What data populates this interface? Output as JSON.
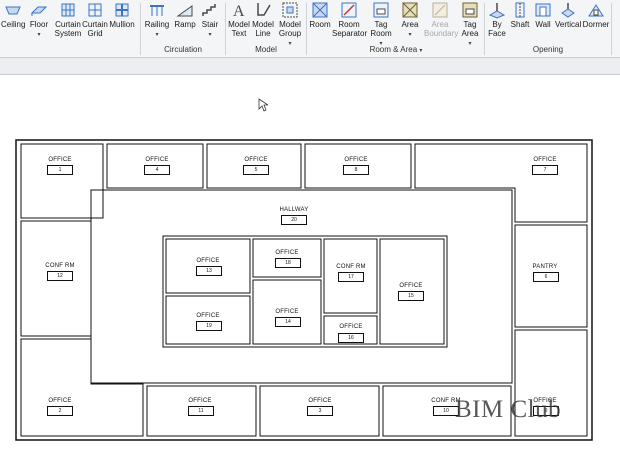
{
  "ribbon": {
    "tools": [
      {
        "label": "Ceiling",
        "icon": "ceiling-icon"
      },
      {
        "label": "Floor",
        "icon": "floor-icon"
      },
      {
        "label": "Curtain System",
        "icon": "curtain-system-icon"
      },
      {
        "label": "Curtain Grid",
        "icon": "curtain-grid-icon"
      },
      {
        "label": "Mullion",
        "icon": "mullion-icon"
      },
      {
        "label": "Railing",
        "icon": "railing-icon"
      },
      {
        "label": "Ramp",
        "icon": "ramp-icon"
      },
      {
        "label": "Stair",
        "icon": "stair-icon"
      },
      {
        "label": "Model Text",
        "icon": "model-text-icon"
      },
      {
        "label": "Model Line",
        "icon": "model-line-icon"
      },
      {
        "label": "Model Group",
        "icon": "model-group-icon"
      },
      {
        "label": "Room",
        "icon": "room-icon"
      },
      {
        "label": "Room Separator",
        "icon": "room-separator-icon"
      },
      {
        "label": "Tag Room",
        "icon": "tag-room-icon"
      },
      {
        "label": "Area",
        "icon": "area-icon"
      },
      {
        "label": "Area Boundary",
        "icon": "area-boundary-icon"
      },
      {
        "label": "Tag Area",
        "icon": "tag-area-icon"
      },
      {
        "label": "By Face",
        "icon": "by-face-icon"
      },
      {
        "label": "Shaft",
        "icon": "shaft-icon"
      },
      {
        "label": "Wall",
        "icon": "wall-opening-icon"
      },
      {
        "label": "Vertical",
        "icon": "vertical-opening-icon"
      },
      {
        "label": "Dormer",
        "icon": "dormer-icon"
      }
    ],
    "panels": [
      "Circulation",
      "Model",
      "Room & Area",
      "Opening"
    ],
    "dropdown_glyph": "▾"
  },
  "plan": {
    "rooms": [
      {
        "name": "OFFICE",
        "number": "1"
      },
      {
        "name": "OFFICE",
        "number": "4"
      },
      {
        "name": "OFFICE",
        "number": "5"
      },
      {
        "name": "OFFICE",
        "number": "8"
      },
      {
        "name": "OFFICE",
        "number": "7"
      },
      {
        "name": "HALLWAY",
        "number": "20"
      },
      {
        "name": "CONF RM",
        "number": "12"
      },
      {
        "name": "PANTRY",
        "number": "6"
      },
      {
        "name": "OFFICE",
        "number": "13"
      },
      {
        "name": "OFFICE",
        "number": "18"
      },
      {
        "name": "CONF RM",
        "number": "17"
      },
      {
        "name": "OFFICE",
        "number": "15"
      },
      {
        "name": "OFFICE",
        "number": "19"
      },
      {
        "name": "OFFICE",
        "number": "14"
      },
      {
        "name": "OFFICE",
        "number": "16"
      },
      {
        "name": "OFFICE",
        "number": "2"
      },
      {
        "name": "OFFICE",
        "number": "11"
      },
      {
        "name": "OFFICE",
        "number": "3"
      },
      {
        "name": "CONF RM",
        "number": "10"
      },
      {
        "name": "OFFICE",
        "number": "9"
      }
    ]
  },
  "watermark": "BIM Club",
  "colors": {
    "ribbon_bg": "#f4f5f7",
    "icon_blue": "#3a74c4",
    "icon_dark": "#4a4a4a",
    "wall": "#111111"
  }
}
